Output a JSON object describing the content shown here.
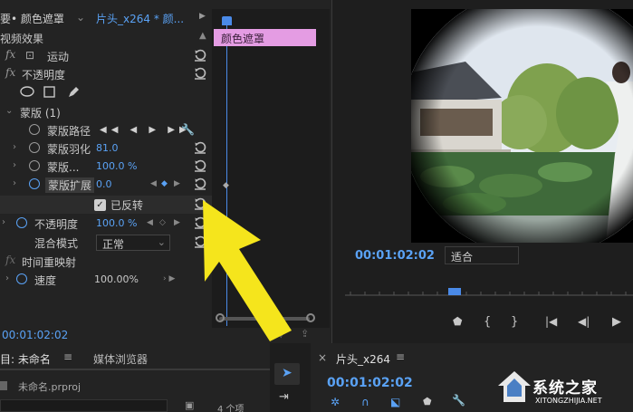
{
  "effect_controls": {
    "tab_title": "要• 颜色遮罩",
    "clip_dropdown": "片头_x264 * 颜...",
    "section_video_effects": "视频效果",
    "motion": "运动",
    "opacity": "不透明度",
    "mask_group": "蒙版 (1)",
    "mask_path": "蒙版路径",
    "mask_feather": "蒙版羽化",
    "mask_feather_value": "81.0",
    "mask_opacity": "蒙版...",
    "mask_opacity_value": "100.0 %",
    "mask_expansion": "蒙版扩展",
    "mask_expansion_value": "0.0",
    "inverted_label": "已反转",
    "inverted_checked": true,
    "opacity2": "不透明度",
    "opacity2_value": "100.0 %",
    "blend_mode": "混合模式",
    "blend_value": "正常",
    "time_remap": "时间重映射",
    "speed": "速度",
    "speed_value": "100.00%",
    "timecode": "00:01:02:02",
    "clip_bar_label": "颜色遮罩",
    "clip_bar_color": "#e49ce3"
  },
  "program_monitor": {
    "timecode": "00:01:02:02",
    "fit_value": "适合"
  },
  "project_panel": {
    "tab_title": "目: 未命名",
    "media_browser": "媒体浏览器",
    "file_name": "未命名.prproj",
    "item_count": "4 个项"
  },
  "timeline_panel": {
    "tab_title": "片头_x264",
    "timecode": "00:01:02:02"
  },
  "watermark": {
    "title": "系统之家",
    "url": "XITONGZHIJIA.NET"
  },
  "colors": {
    "accent_blue": "#5aa2f5",
    "arrow_yellow": "#f5e51c"
  }
}
